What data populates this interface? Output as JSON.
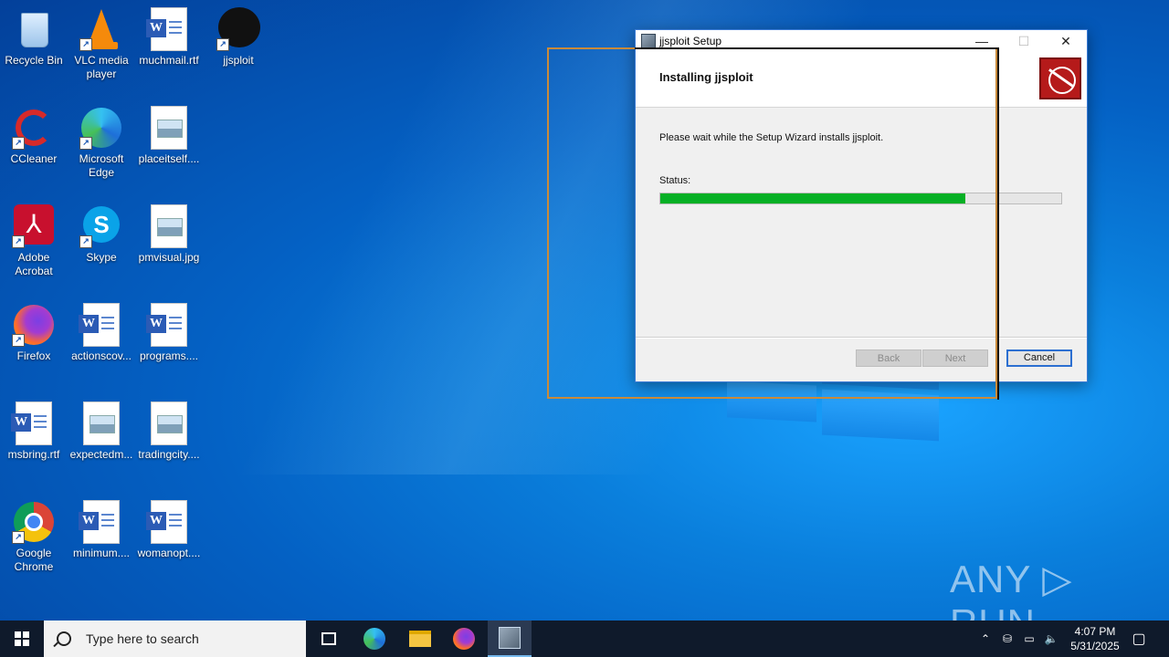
{
  "desktop": {
    "icons": [
      {
        "label": "Recycle Bin"
      },
      {
        "label": "VLC media player"
      },
      {
        "label": "muchmail.rtf"
      },
      {
        "label": "jjsploit"
      },
      {
        "label": "CCleaner"
      },
      {
        "label": "Microsoft Edge"
      },
      {
        "label": "placeitself...."
      },
      {
        "label": "Adobe Acrobat"
      },
      {
        "label": "Skype"
      },
      {
        "label": "pmvisual.jpg"
      },
      {
        "label": "Firefox"
      },
      {
        "label": "actionscov..."
      },
      {
        "label": "programs...."
      },
      {
        "label": "msbring.rtf"
      },
      {
        "label": "expectedm..."
      },
      {
        "label": "tradingcity...."
      },
      {
        "label": "Google Chrome"
      },
      {
        "label": "minimum...."
      },
      {
        "label": "womanopt...."
      }
    ]
  },
  "installer": {
    "title": "jjsploit Setup",
    "heading": "Installing jjsploit",
    "message": "Please wait while the Setup Wizard installs jjsploit.",
    "status_label": "Status:",
    "progress_fraction": 0.76,
    "buttons": {
      "back": "Back",
      "next": "Next",
      "cancel": "Cancel"
    },
    "controls": {
      "minimize": "—",
      "maximize": "☐",
      "close": "✕"
    }
  },
  "watermark": "ANY ▷ RUN",
  "taskbar": {
    "search_placeholder": "Type here to search",
    "time": "4:07 PM",
    "date": "5/31/2025"
  },
  "colors": {
    "progress": "#06b025",
    "accent": "#2c6fd1"
  }
}
